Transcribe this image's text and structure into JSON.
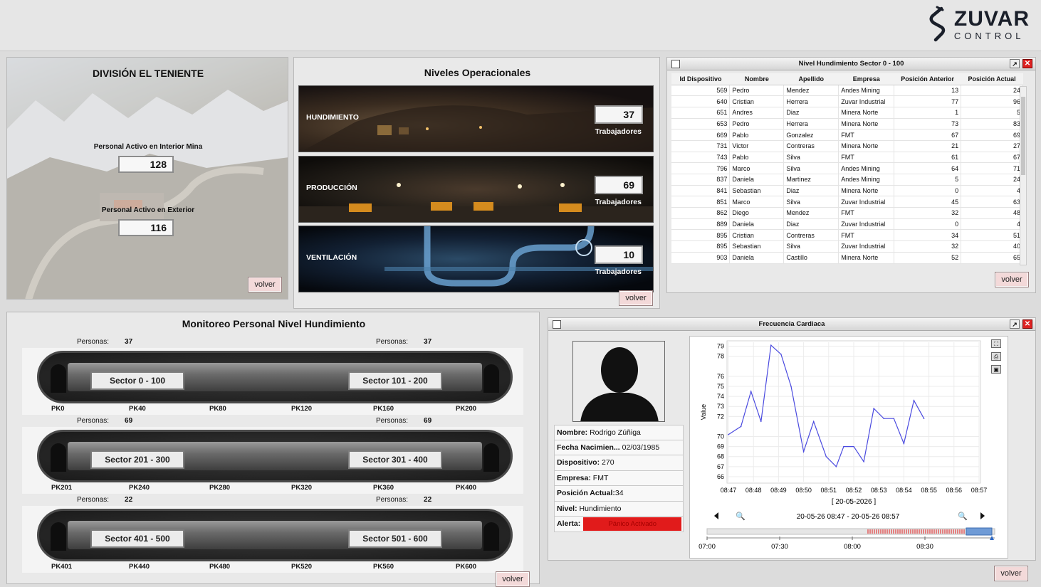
{
  "brand": {
    "name": "ZUVAR",
    "sub": "CONTROL"
  },
  "common": {
    "volver": "volver"
  },
  "division": {
    "title": "DIVISIÓN EL TENIENTE",
    "interior_label": "Personal Activo en Interior Mina",
    "interior_value": "128",
    "exterior_label": "Personal Activo en Exterior",
    "exterior_value": "116"
  },
  "niveles": {
    "title": "Niveles Operacionales",
    "levels": [
      {
        "name": "HUNDIMIENTO",
        "count": "37",
        "unit": "Trabajadores"
      },
      {
        "name": "PRODUCCIÓN",
        "count": "69",
        "unit": "Trabajadores"
      },
      {
        "name": "VENTILACIÓN",
        "count": "10",
        "unit": "Trabajadores"
      }
    ]
  },
  "table": {
    "title": "Nivel Hundimiento Sector 0 - 100",
    "headers": [
      "Id Dispositivo",
      "Nombre",
      "Apellido",
      "Empresa",
      "Posición Anterior",
      "Posición Actual"
    ],
    "rows": [
      [
        "569",
        "Pedro",
        "Mendez",
        "Andes Mining",
        "13",
        "24"
      ],
      [
        "640",
        "Cristian",
        "Herrera",
        "Zuvar Industrial",
        "77",
        "96"
      ],
      [
        "651",
        "Andres",
        "Diaz",
        "Minera Norte",
        "1",
        "5"
      ],
      [
        "653",
        "Pedro",
        "Herrera",
        "Minera Norte",
        "73",
        "83"
      ],
      [
        "669",
        "Pablo",
        "Gonzalez",
        "FMT",
        "67",
        "69"
      ],
      [
        "731",
        "Victor",
        "Contreras",
        "Minera Norte",
        "21",
        "27"
      ],
      [
        "743",
        "Pablo",
        "Silva",
        "FMT",
        "61",
        "67"
      ],
      [
        "796",
        "Marco",
        "Silva",
        "Andes Mining",
        "64",
        "71"
      ],
      [
        "837",
        "Daniela",
        "Martinez",
        "Andes Mining",
        "5",
        "24"
      ],
      [
        "841",
        "Sebastian",
        "Diaz",
        "Minera Norte",
        "0",
        "4"
      ],
      [
        "851",
        "Marco",
        "Silva",
        "Zuvar Industrial",
        "45",
        "63"
      ],
      [
        "862",
        "Diego",
        "Mendez",
        "FMT",
        "32",
        "48"
      ],
      [
        "889",
        "Daniela",
        "Diaz",
        "Zuvar Industrial",
        "0",
        "4"
      ],
      [
        "895",
        "Cristian",
        "Contreras",
        "FMT",
        "34",
        "51"
      ],
      [
        "895",
        "Sebastian",
        "Silva",
        "Zuvar Industrial",
        "32",
        "40"
      ],
      [
        "903",
        "Daniela",
        "Castillo",
        "Minera Norte",
        "52",
        "65"
      ]
    ]
  },
  "monitoreo": {
    "title": "Monitoreo Personal Nivel Hundimiento",
    "personas_label": "Personas:",
    "tunnels": [
      {
        "left_count": "37",
        "right_count": "37",
        "left_sector": "Sector 0 - 100",
        "right_sector": "Sector 101 - 200",
        "pks": [
          "PK0",
          "PK40",
          "PK80",
          "PK120",
          "PK160",
          "PK200"
        ]
      },
      {
        "left_count": "69",
        "right_count": "69",
        "left_sector": "Sector 201 - 300",
        "right_sector": "Sector 301 - 400",
        "pks": [
          "PK201",
          "PK240",
          "PK280",
          "PK320",
          "PK360",
          "PK400"
        ]
      },
      {
        "left_count": "22",
        "right_count": "22",
        "left_sector": "Sector 401 - 500",
        "right_sector": "Sector 501 - 600",
        "pks": [
          "PK401",
          "PK440",
          "PK480",
          "PK520",
          "PK560",
          "PK600"
        ]
      }
    ]
  },
  "freq": {
    "title": "Frecuencia Cardiaca",
    "person": {
      "nombre_label": "Nombre:",
      "nombre": "Rodrigo Zúñiga",
      "fecha_label": "Fecha Nacimien...",
      "fecha": "02/03/1985",
      "disp_label": "Dispositivo:",
      "disp": "270",
      "empresa_label": "Empresa:",
      "empresa": "FMT",
      "pos_label": "Posición Actual:",
      "pos": "34",
      "nivel_label": "Nivel:",
      "nivel": "Hundimiento",
      "alerta_label": "Alerta:",
      "alerta": "Pánico Activado"
    },
    "range_label": "20-05-26 08:47 - 20-05-26 08:57",
    "nav_ticks": [
      "07:00",
      "07:30",
      "08:00",
      "08:30"
    ],
    "accent_red": "#e11b1b"
  },
  "chart_data": {
    "type": "line",
    "ylabel": "Value",
    "xlabel": "[ 20-05-2026 ]",
    "x_ticks": [
      "08:47",
      "08:48",
      "08:49",
      "08:50",
      "08:51",
      "08:52",
      "08:53",
      "08:54",
      "08:55",
      "08:56",
      "08:57"
    ],
    "y_ticks": [
      66,
      67,
      68,
      69,
      70,
      72,
      73,
      74,
      75,
      76,
      78,
      79
    ],
    "ylim": [
      65.5,
      79.4
    ],
    "color": "#4a4adf",
    "values": [
      [
        0.0,
        70.2
      ],
      [
        0.5,
        71.0
      ],
      [
        0.9,
        74.5
      ],
      [
        1.3,
        71.5
      ],
      [
        1.7,
        79.1
      ],
      [
        2.1,
        78.2
      ],
      [
        2.5,
        75.0
      ],
      [
        3.0,
        68.5
      ],
      [
        3.4,
        71.5
      ],
      [
        3.9,
        68.0
      ],
      [
        4.3,
        67.0
      ],
      [
        4.6,
        69.0
      ],
      [
        5.0,
        69.0
      ],
      [
        5.4,
        67.5
      ],
      [
        5.8,
        72.8
      ],
      [
        6.2,
        71.8
      ],
      [
        6.6,
        71.8
      ],
      [
        7.0,
        69.3
      ],
      [
        7.4,
        73.6
      ],
      [
        7.8,
        71.8
      ]
    ]
  }
}
